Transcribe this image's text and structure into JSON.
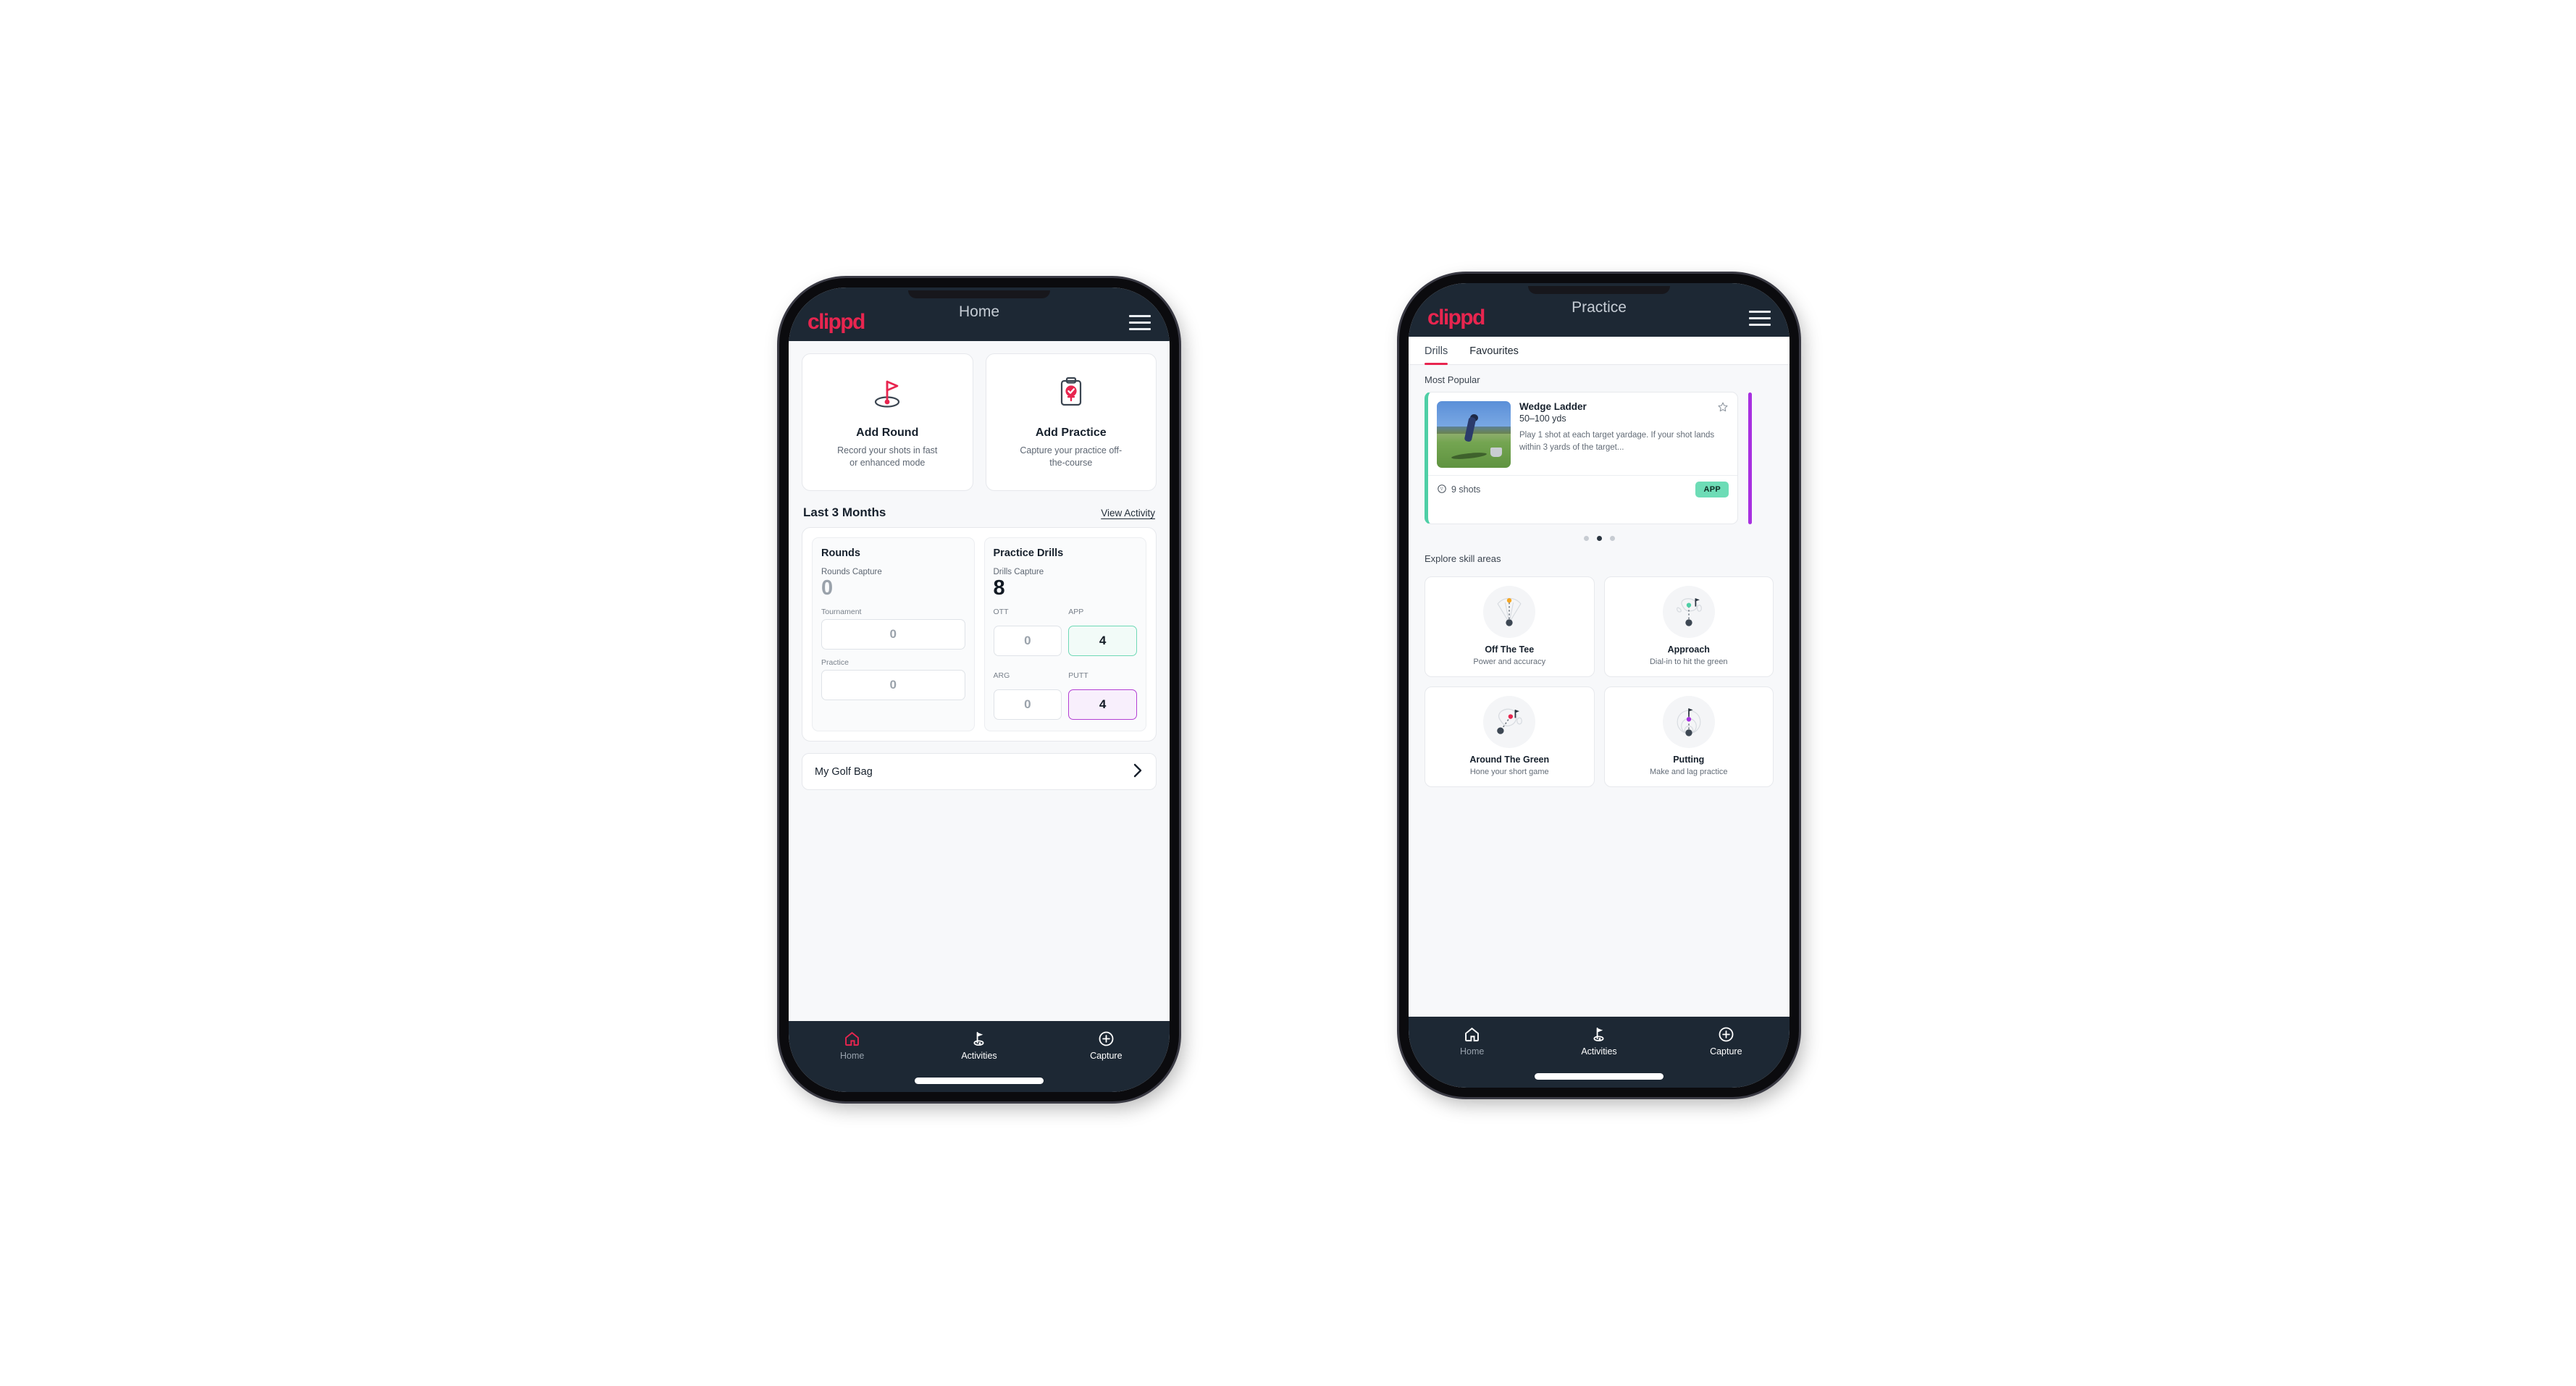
{
  "home": {
    "appbar": {
      "logo": "clippd",
      "title": "Home",
      "menu_icon": "hamburger-icon"
    },
    "actions": [
      {
        "icon": "golf-flag-hole-icon",
        "title": "Add Round",
        "subtitle": "Record your shots in fast or enhanced mode"
      },
      {
        "icon": "clipboard-check-icon",
        "title": "Add Practice",
        "subtitle": "Capture your practice off-the-course"
      }
    ],
    "section": {
      "title": "Last 3 Months",
      "link": "View Activity"
    },
    "rounds": {
      "title": "Rounds",
      "capture_label": "Rounds Capture",
      "capture_value": "0",
      "fields": [
        {
          "label": "Tournament",
          "value": "0"
        },
        {
          "label": "Practice",
          "value": "0"
        }
      ]
    },
    "drills": {
      "title": "Practice Drills",
      "capture_label": "Drills Capture",
      "capture_value": "8",
      "fields": [
        {
          "label": "OTT",
          "value": "0",
          "highlight": "none"
        },
        {
          "label": "APP",
          "value": "4",
          "highlight": "green"
        },
        {
          "label": "ARG",
          "value": "0",
          "highlight": "none"
        },
        {
          "label": "PUTT",
          "value": "4",
          "highlight": "purple"
        }
      ]
    },
    "golf_bag": {
      "label": "My Golf Bag",
      "chevron": "chevron-right-icon"
    },
    "nav": [
      {
        "label": "Home",
        "icon": "home-icon",
        "state": "active-red"
      },
      {
        "label": "Activities",
        "icon": "golf-flag-icon",
        "state": "active"
      },
      {
        "label": "Capture",
        "icon": "plus-circle-icon",
        "state": "inactive-white"
      }
    ]
  },
  "practice": {
    "appbar": {
      "logo": "clippd",
      "title": "Practice",
      "menu_icon": "hamburger-icon"
    },
    "tabs": [
      {
        "label": "Drills",
        "active": true
      },
      {
        "label": "Favourites",
        "active": false
      }
    ],
    "most_popular_label": "Most Popular",
    "drill": {
      "title": "Wedge Ladder",
      "yardage": "50–100 yds",
      "description": "Play 1 shot at each target yardage. If your shot lands within 3 yards of the target...",
      "shots": "9 shots",
      "shots_icon": "golf-ball-icon",
      "tag": "APP",
      "favourite_icon": "star-outline-icon",
      "accent_color": "#4ecfa6",
      "next_accent_color": "#a830e0"
    },
    "carousel_dots": [
      false,
      true,
      false
    ],
    "explore_label": "Explore skill areas",
    "skills": [
      {
        "title": "Off The Tee",
        "subtitle": "Power and accuracy",
        "icon": "tee-shot-dispersion-icon",
        "dot_color": "#f5a623"
      },
      {
        "title": "Approach",
        "subtitle": "Dial-in to hit the green",
        "icon": "approach-green-icon",
        "dot_color": "#4ecfa6"
      },
      {
        "title": "Around The Green",
        "subtitle": "Hone your short game",
        "icon": "chip-green-icon",
        "dot_color": "#e8254f"
      },
      {
        "title": "Putting",
        "subtitle": "Make and lag practice",
        "icon": "putting-rings-icon",
        "dot_color": "#a830e0"
      }
    ],
    "nav": [
      {
        "label": "Home",
        "icon": "home-icon",
        "state": "inactive"
      },
      {
        "label": "Activities",
        "icon": "golf-flag-icon",
        "state": "active"
      },
      {
        "label": "Capture",
        "icon": "plus-circle-icon",
        "state": "inactive-white"
      }
    ]
  },
  "theme": {
    "appbar_bg": "#1d2834",
    "brand": "#e8254f",
    "page_bg": "#f7f8fa",
    "accent_green": "#4ecfa6",
    "accent_purple": "#a830e0"
  }
}
